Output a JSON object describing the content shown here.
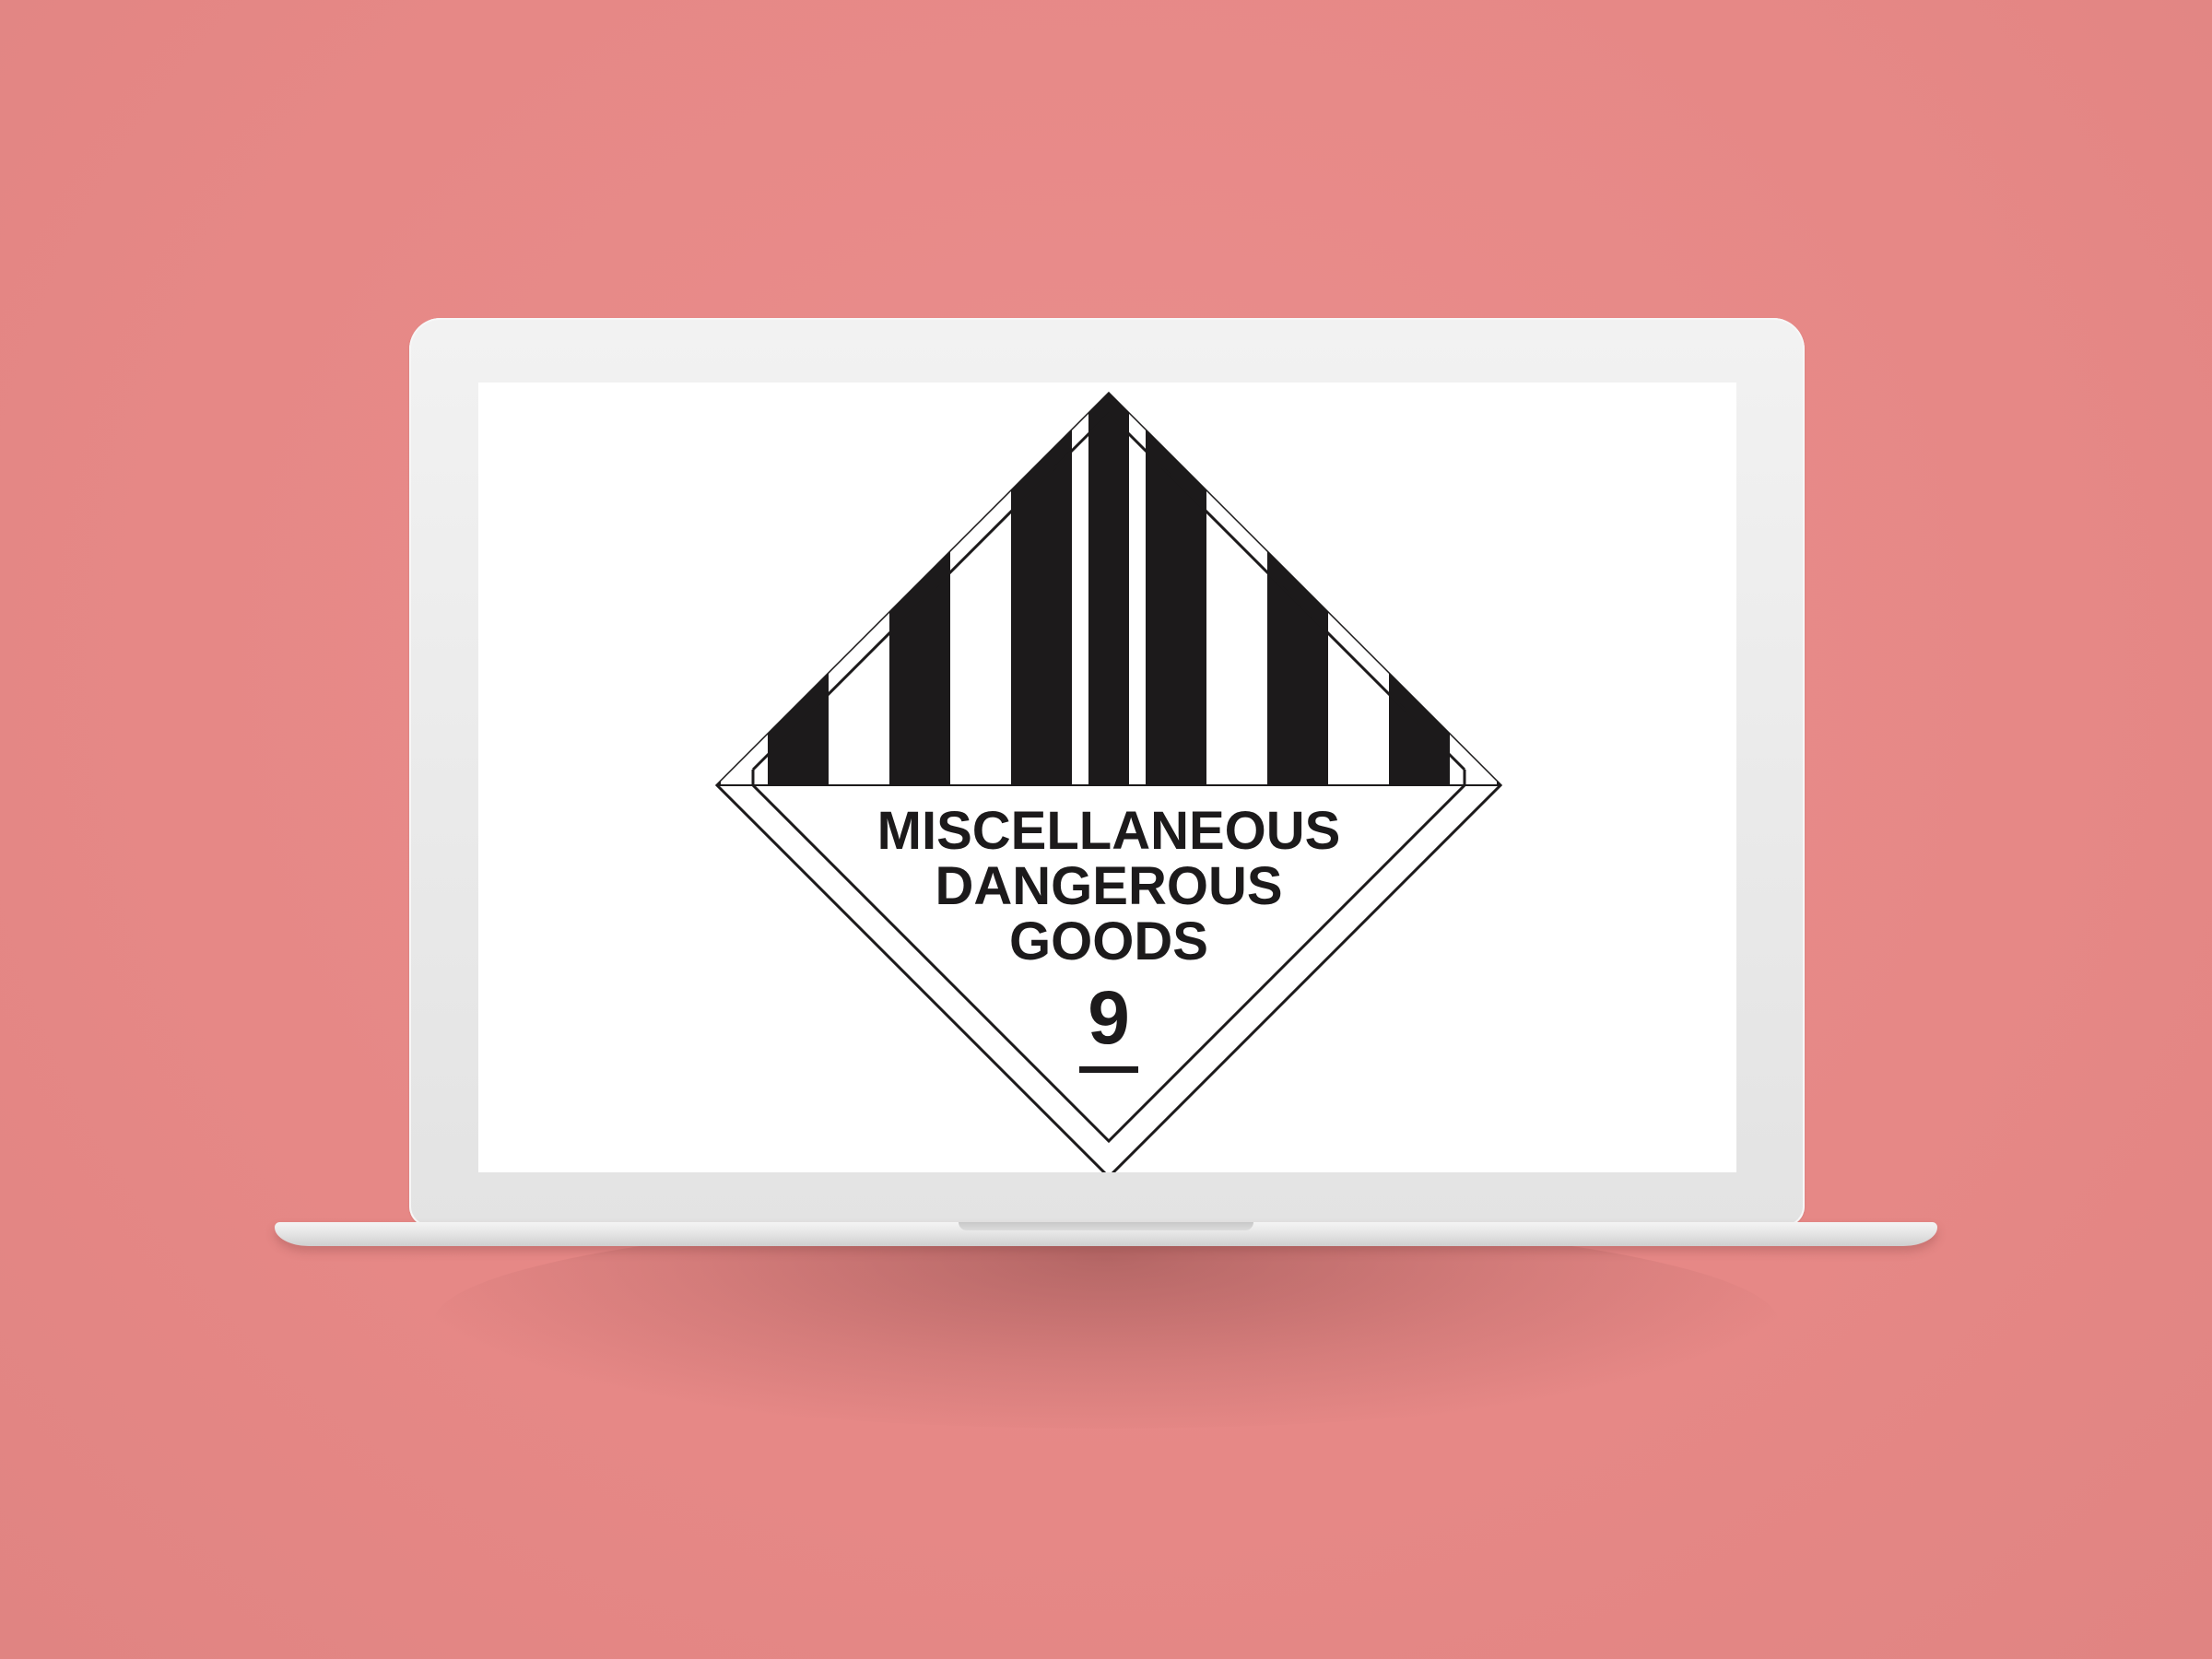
{
  "scene": {
    "background_color": "#e88b8a",
    "device": "laptop-mockup"
  },
  "placard": {
    "line1": "MISCELLANEOUS",
    "line2": "DANGEROUS",
    "line3": "GOODS",
    "class_number": "9",
    "ink_color": "#1c1a1b",
    "paper_color": "#ffffff"
  }
}
